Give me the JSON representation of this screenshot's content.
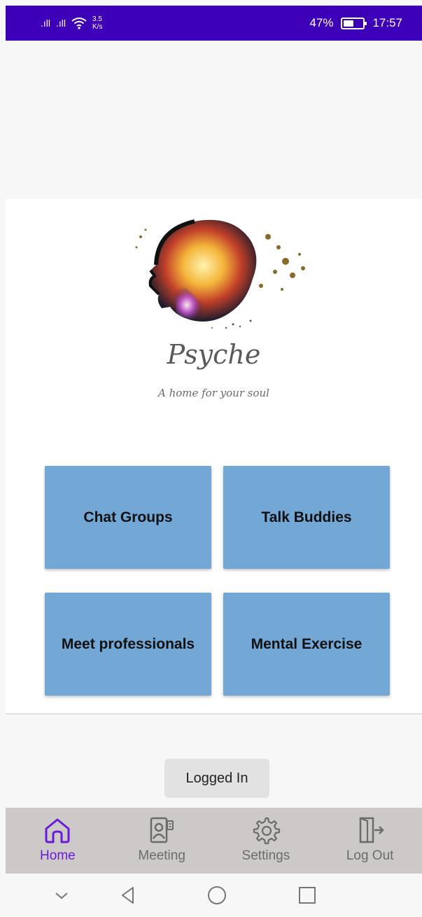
{
  "status_bar": {
    "signal_1": ".ıll",
    "signal_2": ".ıll",
    "wifi_icon": "wifi-icon",
    "speed_value": "3.5",
    "speed_unit": "K/s",
    "battery": "47%",
    "time": "17:57"
  },
  "logo": {
    "title": "Psyche",
    "tagline": "A home for your soul"
  },
  "tiles": [
    {
      "label": "Chat Groups"
    },
    {
      "label": "Talk Buddies"
    },
    {
      "label": "Meet professionals"
    },
    {
      "label": "Mental Exercise"
    }
  ],
  "toast": {
    "text": "Logged In"
  },
  "bottom_nav": {
    "items": [
      {
        "label": "Home",
        "icon": "home-icon",
        "active": true
      },
      {
        "label": "Meeting",
        "icon": "meeting-icon",
        "active": false
      },
      {
        "label": "Settings",
        "icon": "gear-icon",
        "active": false
      },
      {
        "label": "Log Out",
        "icon": "logout-icon",
        "active": false
      }
    ]
  },
  "colors": {
    "status_bar": "#3d00b8",
    "tile": "#72a7d6",
    "active_nav": "#6a1bd6",
    "nav_background": "#cdc9c9"
  }
}
